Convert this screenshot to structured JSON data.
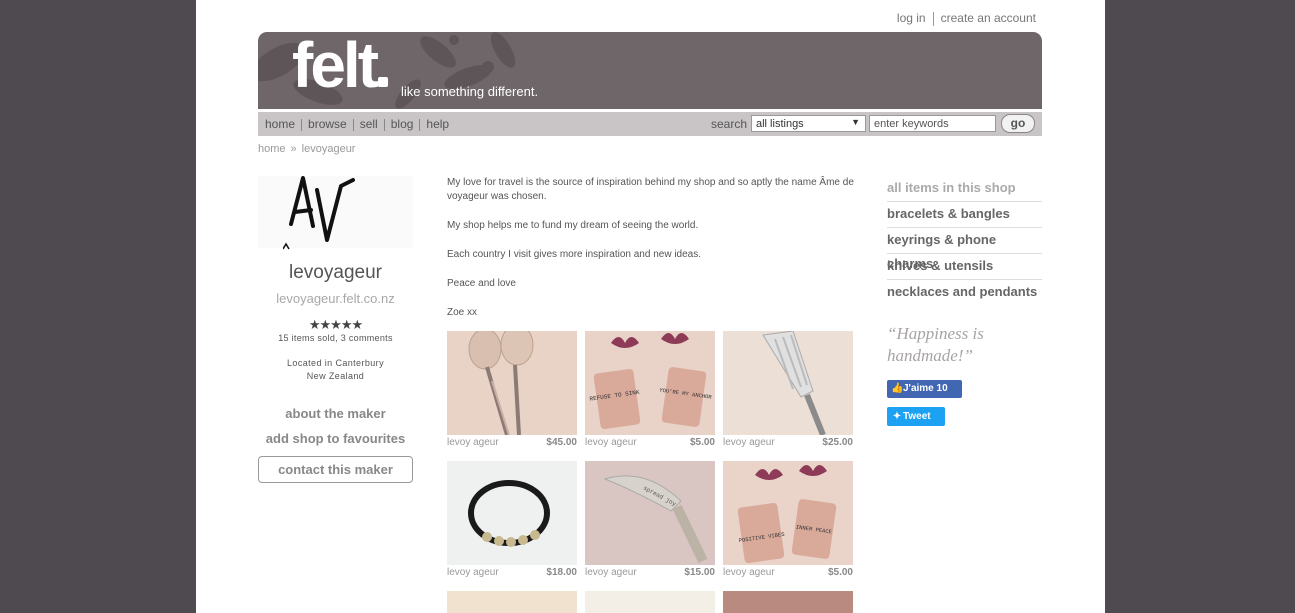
{
  "header": {
    "login": "log in",
    "create_account": "create an account",
    "logo": "felt",
    "tagline": "like something different."
  },
  "nav": {
    "items": [
      "home",
      "browse",
      "sell",
      "blog",
      "help"
    ],
    "search_label": "search",
    "search_scope": "all listings",
    "search_placeholder": "enter keywords",
    "go": "go"
  },
  "breadcrumb": {
    "home": "home",
    "sep": "»",
    "current": "levoyageur"
  },
  "shop": {
    "name": "levoyageur",
    "url": "levoyageur.felt.co.nz",
    "rating_stars": "★★★★★",
    "rating": 5,
    "sold_text": "15 items sold, 3 comments",
    "location_line1": "Located in Canterbury",
    "location_line2": "New Zealand",
    "about": "about the maker",
    "favourite": "add shop to favourites",
    "contact": "contact this maker"
  },
  "description": {
    "p1": "My love for travel is the source of inspiration behind my shop and so aptly the name Âme de voyageur was chosen.",
    "p2": "My shop helps me to fund my dream of seeing the world.",
    "p3": "Each country I visit gives more inspiration and new ideas.",
    "p4": "Peace and love",
    "p5": "Zoe xx"
  },
  "listings": [
    {
      "seller": "levoy ageur",
      "price": "$45.00",
      "image": "spoons"
    },
    {
      "seller": "levoy ageur",
      "price": "$5.00",
      "image": "anchor-tags",
      "tag1": "REFUSE TO SINK",
      "tag2": "YOU'RE MY ANCHOR"
    },
    {
      "seller": "levoy ageur",
      "price": "$25.00",
      "image": "server"
    },
    {
      "seller": "levoy ageur",
      "price": "$18.00",
      "image": "bracelet"
    },
    {
      "seller": "levoy ageur",
      "price": "$15.00",
      "image": "knife",
      "engraving": "spread joy"
    },
    {
      "seller": "levoy ageur",
      "price": "$5.00",
      "image": "om-tags",
      "tag1": "POSITIVE VIBES",
      "tag2": "INNER PEACE"
    }
  ],
  "categories": [
    "all items in this shop",
    "bracelets & bangles",
    "keyrings & phone charms",
    "knives & utensils",
    "necklaces and pendants"
  ],
  "quote": "“Happiness is handmade!”",
  "social": {
    "fb_label": "J'aime 10",
    "tw_label": "Tweet"
  }
}
